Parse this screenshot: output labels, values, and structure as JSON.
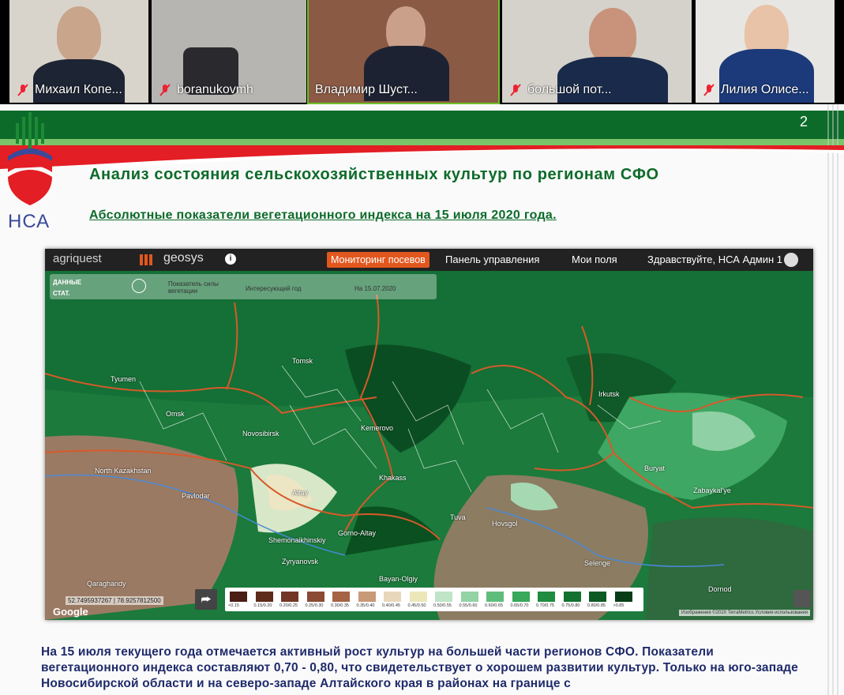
{
  "participants": [
    {
      "name": "Михаил Копе..."
    },
    {
      "name": "boranukovmh"
    },
    {
      "name": "Владимир Шуст..."
    },
    {
      "name": "большой пот..."
    },
    {
      "name": "Лилия Олисе..."
    }
  ],
  "slide": {
    "page_number": "2",
    "logo_text": "НСА",
    "title": "Анализ состояния сельскохозяйственных культур по регионам СФО",
    "subtitle": "Абсолютные  показатели вегетационного индекса  на 15  июля  2020 года.",
    "body_text": "На 15 июля текущего года отмечается активный рост культур на большей части регионов СФО. Показатели вегетационного индекса составляют 0,70 - 0,80, что свидетельствует о хорошем развитии культур. Только на юго-западе Новосибирской области и на северо-западе Алтайского края в районах на границе с"
  },
  "app": {
    "brand_left": "agriquest",
    "brand_right": "geosys",
    "nav_active": "Мониторинг посевов",
    "nav": [
      "Панель управления",
      "Мои поля",
      "Здравствуйте, НСА Админ 1"
    ],
    "panel": {
      "tab_data": "ДАННЫЕ",
      "tab_stat": "СТАТ.",
      "field1": "Показатель силы вегетации",
      "field2": "Интересующий год",
      "date": "На 15.07.2020"
    },
    "coords": "52.7495937267 | 78.9257812500",
    "google": "Google",
    "attribution": "Изображения ©2020 TerraMetrics   Условия использования"
  },
  "map_labels": [
    "Tomsk",
    "Tyumen",
    "Novosibirsk",
    "Kemerovo",
    "Khakass",
    "Altay",
    "Gorno-Altay",
    "Tuva",
    "Irkutsk",
    "Buryat",
    "Zabaykal'ye",
    "North Kazakhstan",
    "Pavlodar",
    "Hovsgol",
    "Selenge",
    "Dornod",
    "Qaraghandy",
    "Bayan-Olgiy",
    "Omsk",
    "Zyryanovsk",
    "Shemonaikhinskiy"
  ],
  "legend": [
    {
      "label": "<0.15",
      "color": "#4a1e14"
    },
    {
      "label": "0.15/0.20",
      "color": "#5e2a1c"
    },
    {
      "label": "0.20/0.25",
      "color": "#733626"
    },
    {
      "label": "0.25/0.30",
      "color": "#8a4a33"
    },
    {
      "label": "0.30/0.35",
      "color": "#a46445"
    },
    {
      "label": "0.35/0.40",
      "color": "#c89a78"
    },
    {
      "label": "0.40/0.45",
      "color": "#e8d7bd"
    },
    {
      "label": "0.45/0.50",
      "color": "#ece7b8"
    },
    {
      "label": "0.50/0.55",
      "color": "#bfe4c6"
    },
    {
      "label": "0.55/0.60",
      "color": "#93d3a4"
    },
    {
      "label": "0.60/0.65",
      "color": "#5fbd7c"
    },
    {
      "label": "0.65/0.70",
      "color": "#38a85a"
    },
    {
      "label": "0.70/0.75",
      "color": "#1f8c3f"
    },
    {
      "label": "0.75/0.80",
      "color": "#137230"
    },
    {
      "label": "0.80/0.85",
      "color": "#0b5a24"
    },
    {
      "label": ">0.85",
      "color": "#063d17"
    }
  ]
}
